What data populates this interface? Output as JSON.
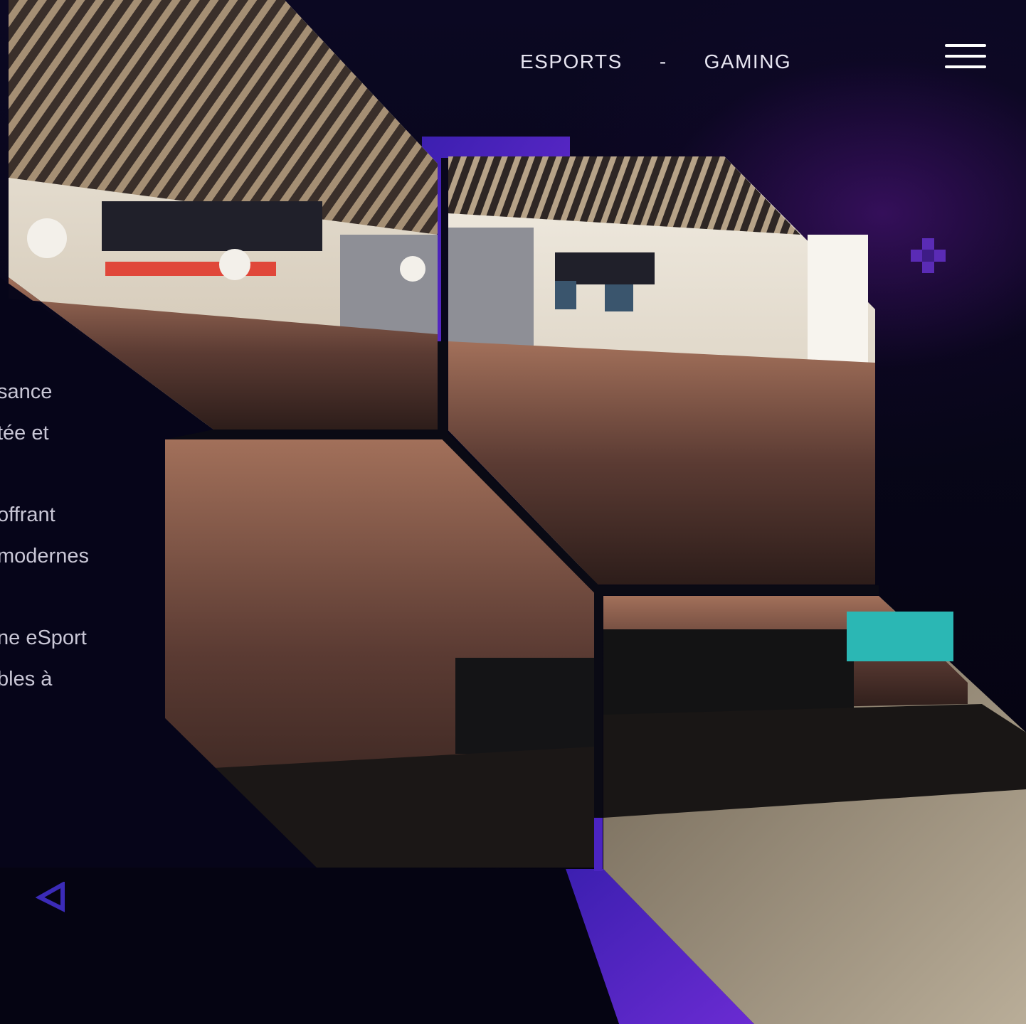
{
  "nav": {
    "items": [
      {
        "label": "ESPORTS"
      },
      {
        "label": "GAMING"
      }
    ],
    "separator": "-"
  },
  "menu_icon": "hamburger-menu-icon",
  "intro": {
    "lines": [
      "sance",
      "tée et",
      "",
      "offrant",
      "modernes",
      "",
      "ne eSport",
      "bles à"
    ]
  },
  "photos": {
    "subject": "esports event crowd in a food court",
    "accent_color": "#5a2bd6"
  },
  "colors": {
    "background": "#050413",
    "accent": "#5a2bd6",
    "accent_dark": "#3a1fa8",
    "text": "#e6e4f0"
  },
  "decorations": [
    "plus-icon",
    "triangle-outline-icon"
  ]
}
